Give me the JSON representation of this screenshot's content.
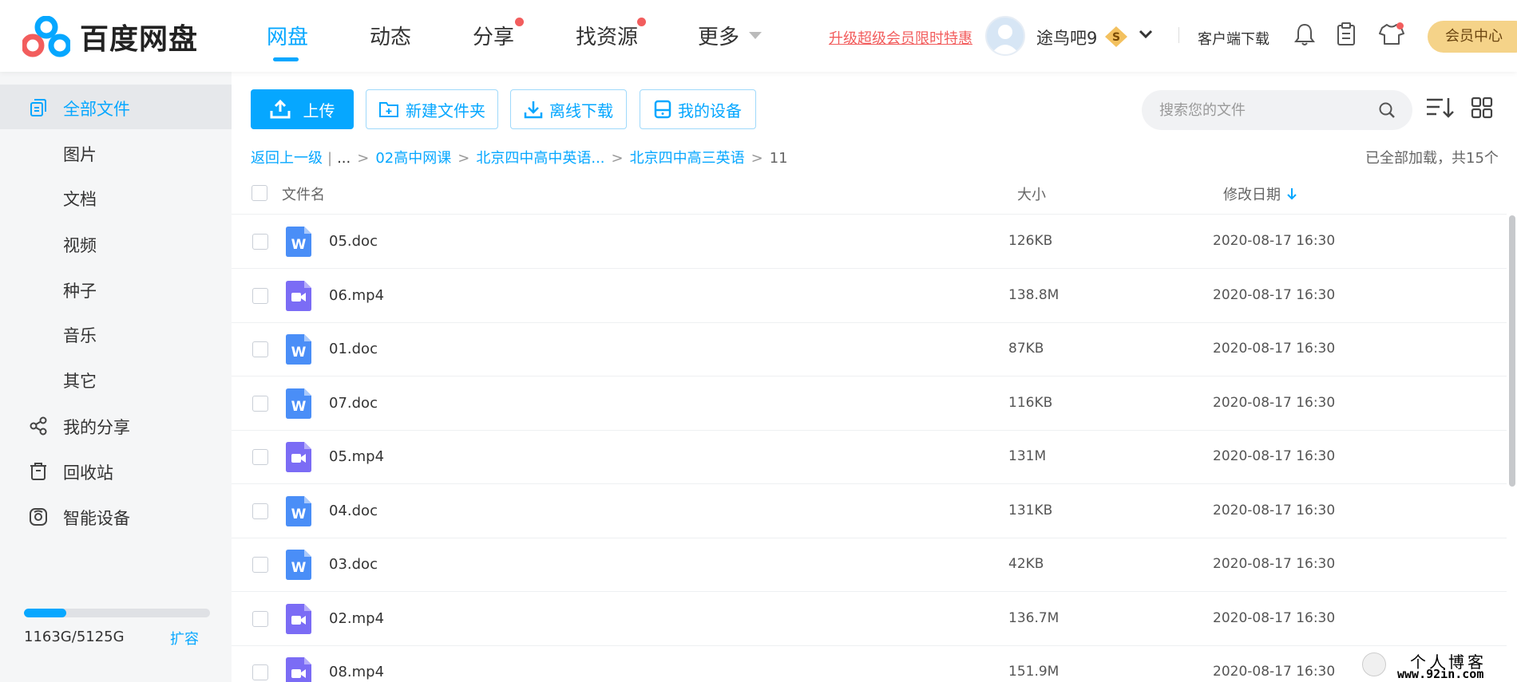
{
  "header": {
    "logo_text": "百度网盘",
    "nav": [
      {
        "label": "网盘",
        "active": true
      },
      {
        "label": "动态"
      },
      {
        "label": "分享",
        "dot": true
      },
      {
        "label": "找资源",
        "dot": true
      },
      {
        "label": "更多"
      }
    ],
    "promo": "升级超级会员限时特惠",
    "username": "途鸟吧9",
    "vip_badge": "S",
    "client_download": "客户端下载",
    "vip_center": "会员中心"
  },
  "sidebar": {
    "items": [
      {
        "label": "全部文件",
        "icon": "files-icon",
        "active": true
      },
      {
        "label": "图片"
      },
      {
        "label": "文档"
      },
      {
        "label": "视频"
      },
      {
        "label": "种子"
      },
      {
        "label": "音乐"
      },
      {
        "label": "其它"
      },
      {
        "label": "我的分享",
        "icon": "share-icon"
      },
      {
        "label": "回收站",
        "icon": "trash-icon"
      },
      {
        "label": "智能设备",
        "icon": "device-icon"
      }
    ],
    "quota": {
      "text": "1163G/5125G",
      "used_fraction": 0.227,
      "expand": "扩容"
    }
  },
  "toolbar": {
    "upload": "上传",
    "new_folder": "新建文件夹",
    "offline_download": "离线下载",
    "my_devices": "我的设备",
    "search_placeholder": "搜索您的文件"
  },
  "breadcrumb": {
    "back": "返回上一级",
    "ellipsis": "...",
    "items": [
      "02高中网课",
      "北京四中高中英语...",
      "北京四中高三英语"
    ],
    "current": "11",
    "loaded_text": "已全部加载，共15个"
  },
  "table": {
    "columns": {
      "name": "文件名",
      "size": "大小",
      "date": "修改日期"
    },
    "rows": [
      {
        "name": "05.doc",
        "size": "126KB",
        "date": "2020-08-17 16:30",
        "type": "doc"
      },
      {
        "name": "06.mp4",
        "size": "138.8M",
        "date": "2020-08-17 16:30",
        "type": "video"
      },
      {
        "name": "01.doc",
        "size": "87KB",
        "date": "2020-08-17 16:30",
        "type": "doc"
      },
      {
        "name": "07.doc",
        "size": "116KB",
        "date": "2020-08-17 16:30",
        "type": "doc"
      },
      {
        "name": "05.mp4",
        "size": "131M",
        "date": "2020-08-17 16:30",
        "type": "video"
      },
      {
        "name": "04.doc",
        "size": "131KB",
        "date": "2020-08-17 16:30",
        "type": "doc"
      },
      {
        "name": "03.doc",
        "size": "42KB",
        "date": "2020-08-17 16:30",
        "type": "doc"
      },
      {
        "name": "02.mp4",
        "size": "136.7M",
        "date": "2020-08-17 16:30",
        "type": "video"
      },
      {
        "name": "08.mp4",
        "size": "151.9M",
        "date": "2020-08-17 16:30",
        "type": "video"
      }
    ]
  },
  "watermark": {
    "line1": "个人博客",
    "line2": "www.92in.com"
  },
  "colors": {
    "accent": "#06a7ff",
    "alert": "#f25d5d",
    "doc_icon": "#4a8ef7",
    "video_icon": "#7b6cf5",
    "vip": "#f5d389"
  }
}
